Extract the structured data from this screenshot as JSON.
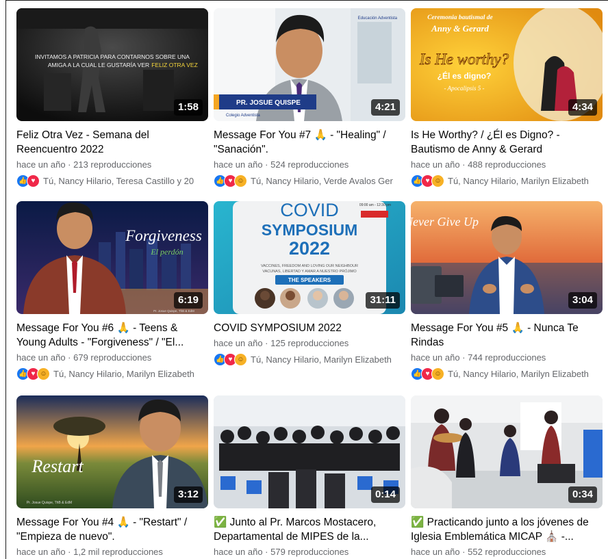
{
  "colors": {
    "like": "#1877f2",
    "love": "#f02849",
    "haha": "#f7b125",
    "meta": "#65676b"
  },
  "videos": [
    {
      "thumb_text": [
        "INVITAMOS A PATRICIA PARA CONTARNOS SOBRE UNA",
        "AMIGA A LA CUAL LE GUSTARÍA VER",
        "FELIZ OTRA VEZ"
      ],
      "duration": "1:58",
      "title": "Feliz Otra Vez - Semana del Reencuentro 2022",
      "meta": "hace un año · 213 reproducciones",
      "reactions": [
        "like",
        "love"
      ],
      "names": "Tú, Nancy Hilario, Teresa Castillo y 20"
    },
    {
      "thumb_text": [
        "PR. JOSUE QUISPE",
        "Colegio Adventista",
        "Educación Adventista"
      ],
      "duration": "4:21",
      "title": "Message For You #7 🙏 - \"Healing\" / \"Sanación\".",
      "meta": "hace un año · 524 reproducciones",
      "reactions": [
        "like",
        "love",
        "haha"
      ],
      "names": "Tú, Nancy Hilario, Verde Avalos Ger"
    },
    {
      "thumb_text": [
        "Ceremonia bautismal de",
        "Anny & Gerard",
        "Is He worthy?",
        "¿Él es digno?",
        "- Apocalipsis 5 -"
      ],
      "duration": "4:34",
      "title": "Is He Worthy? / ¿Él es Digno? - Bautismo de Anny & Gerard",
      "meta": "hace un año · 488 reproducciones",
      "reactions": [
        "like",
        "love",
        "haha"
      ],
      "names": "Tú, Nancy Hilario, Marilyn Elizabeth"
    },
    {
      "thumb_text": [
        "Forgiveness",
        "El perdón",
        "Pr. Josue Quispe, ThB & EdM"
      ],
      "duration": "6:19",
      "title": "Message For You #6 🙏 - Teens & Young Adults - \"Forgiveness\" / \"El...",
      "meta": "hace un año · 679 reproducciones",
      "reactions": [
        "like",
        "love",
        "haha"
      ],
      "names": "Tú, Nancy Hilario, Marilyn Elizabeth"
    },
    {
      "thumb_text": [
        "COVID",
        "SYMPOSIUM",
        "2022",
        "VACCINES, FREEDOM AND LOVING OUR NEIGHBOUR",
        "VACUNAS, LIBERTAD Y AMAR A NUESTRO PRÓJIMO",
        "THE SPEAKERS",
        "09:00 am - 12:30 pm"
      ],
      "duration": "31:11",
      "title": "COVID SYMPOSIUM 2022",
      "meta": "hace un año · 125 reproducciones",
      "reactions": [
        "like",
        "love",
        "haha"
      ],
      "names": "Tú, Nancy Hilario, Marilyn Elizabeth"
    },
    {
      "thumb_text": [
        "Never Give Up"
      ],
      "duration": "3:04",
      "title": "Message For You #5 🙏 - Nunca Te Rindas",
      "meta": "hace un año · 744 reproducciones",
      "reactions": [
        "like",
        "love",
        "haha"
      ],
      "names": "Tú, Nancy Hilario, Marilyn Elizabeth"
    },
    {
      "thumb_text": [
        "Restart",
        "Pr. Josue Quispe, ThB & EdM"
      ],
      "duration": "3:12",
      "title": "Message For You #4 🙏 - \"Restart\" / \"Empieza de nuevo\".",
      "meta": "hace un año · 1,2 mil reproducciones",
      "reactions": [],
      "names": ""
    },
    {
      "thumb_text": [],
      "duration": "0:14",
      "title": "✅ Junto al Pr. Marcos Mostacero, Departamental de MIPES de la...",
      "meta": "hace un año · 579 reproducciones",
      "reactions": [],
      "names": ""
    },
    {
      "thumb_text": [],
      "duration": "0:34",
      "title": "✅ Practicando junto a los jóvenes de Iglesia Emblemática MICAP ⛪ -...",
      "meta": "hace un año · 552 reproducciones",
      "reactions": [],
      "names": ""
    }
  ]
}
